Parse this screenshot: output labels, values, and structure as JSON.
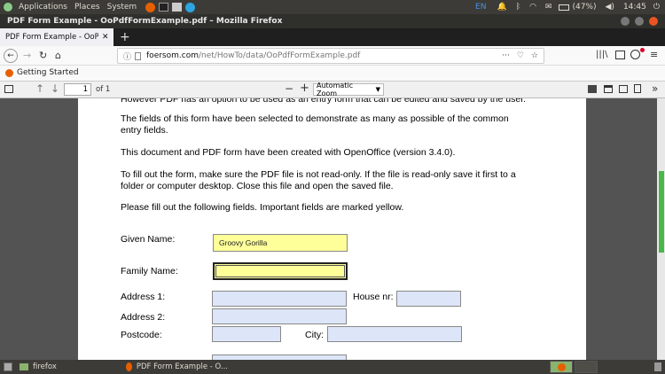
{
  "system_panel": {
    "menus": [
      "Applications",
      "Places",
      "System"
    ],
    "keyboard": "EN",
    "battery": "(47%)",
    "time": "14:45"
  },
  "window": {
    "title": "PDF Form Example - OoPdfFormExample.pdf – Mozilla Firefox"
  },
  "tabs": [
    {
      "label": "PDF Form Example - OoPdf"
    }
  ],
  "nav": {
    "url_domain": "foersom.com",
    "url_path": "/net/HowTo/data/OoPdfFormExample.pdf",
    "ellipsis": "···"
  },
  "bookmarks": [
    {
      "label": "Getting Started"
    }
  ],
  "pdf_toolbar": {
    "page_number": "1",
    "page_count": "of 1",
    "zoom": "Automatic Zoom"
  },
  "document": {
    "truncated_line": "However PDF has an option to be used as an entry form that can be edited and saved by the user.",
    "p1_line1": "The fields of this form have been selected to demonstrate as many as possible of the common",
    "p1_line2": "entry fields.",
    "p2": "This document and PDF form have been created with OpenOffice (version 3.4.0).",
    "p3_line1": "To fill out the form, make sure the PDF file is not read-only. If the file is read-only save it first to a",
    "p3_line2": "folder or computer desktop. Close this file and open the saved file.",
    "p4": "Please fill out the following fields. Important fields are marked yellow."
  },
  "form": {
    "given_name_label": "Given Name:",
    "given_name_value": "Groovy Gorilla",
    "family_name_label": "Family Name:",
    "family_name_value": "",
    "address1_label": "Address 1:",
    "house_nr_label": "House nr:",
    "address2_label": "Address 2:",
    "postcode_label": "Postcode:",
    "city_label": "City:"
  },
  "taskbar": {
    "items": [
      {
        "label": "firefox"
      },
      {
        "label": "PDF Form Example - O..."
      }
    ]
  },
  "colors": {
    "required_field": "#ffff99",
    "optional_field": "#dde6f8",
    "panel_bg": "#3c3b37"
  }
}
